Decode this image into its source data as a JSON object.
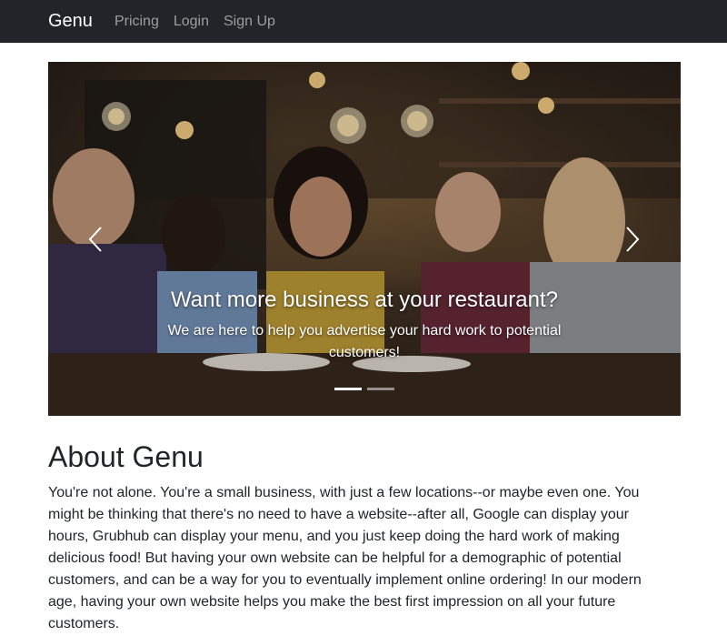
{
  "navbar": {
    "brand": "Genu",
    "links": [
      {
        "label": "Pricing"
      },
      {
        "label": "Login"
      },
      {
        "label": "Sign Up"
      }
    ]
  },
  "carousel": {
    "slide": {
      "title": "Want more business at your restaurant?",
      "text": "We are here to help you advertise your hard work to potential customers!"
    },
    "prev_icon": "chevron-left-icon",
    "next_icon": "chevron-right-icon",
    "active_index": 0,
    "indicator_count": 2
  },
  "about": {
    "heading": "About Genu",
    "body": "You're not alone. You're a small business, with just a few locations--or maybe even one. You might be thinking that there's no need to have a website--after all, Google can display your hours, Grubhub can display your menu, and you just keep doing the hard work of making delicious food! But having your own website can be helpful for a demographic of potential customers, and can be a way for you to eventually implement online ordering! In our modern age, having your own website helps you make the best first impression on all your future customers."
  },
  "colors": {
    "navbar_bg": "#212529",
    "text": "#212529"
  }
}
